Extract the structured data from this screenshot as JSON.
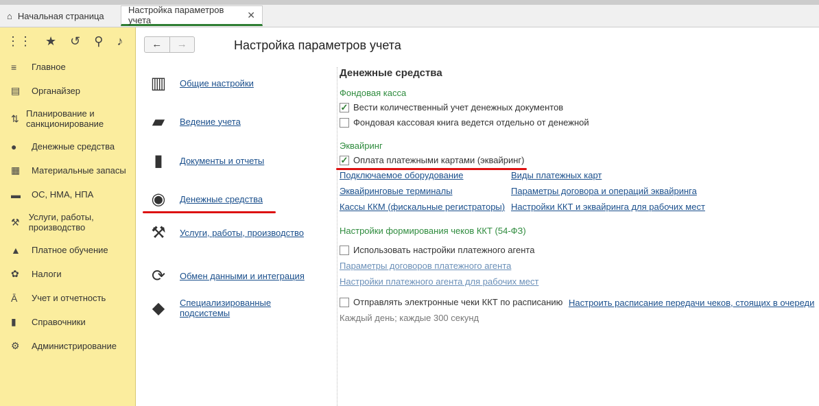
{
  "tabs": {
    "home": "Начальная страница",
    "active": "Настройка параметров учета"
  },
  "sidebar": {
    "items": [
      {
        "icon": "menu-icon",
        "label": "Главное"
      },
      {
        "icon": "organizer-icon",
        "label": "Органайзер"
      },
      {
        "icon": "planning-icon",
        "label": "Планирование и санкционирование"
      },
      {
        "icon": "money-icon",
        "label": "Денежные средства"
      },
      {
        "icon": "stock-icon",
        "label": "Материальные запасы"
      },
      {
        "icon": "truck-icon",
        "label": "ОС, НМА, НПА"
      },
      {
        "icon": "services-icon",
        "label": "Услуги, работы, производство"
      },
      {
        "icon": "education-icon",
        "label": "Платное обучение"
      },
      {
        "icon": "taxes-icon",
        "label": "Налоги"
      },
      {
        "icon": "reporting-icon",
        "label": "Учет и отчетность"
      },
      {
        "icon": "reference-icon",
        "label": "Справочники"
      },
      {
        "icon": "gear-icon",
        "label": "Администрирование"
      }
    ]
  },
  "page": {
    "title": "Настройка параметров учета"
  },
  "menu": [
    {
      "label": "Общие настройки",
      "icon": "building-icon"
    },
    {
      "label": "Ведение учета",
      "icon": "folder-icon"
    },
    {
      "label": "Документы и отчеты",
      "icon": "binder-icon"
    },
    {
      "label": "Денежные средства",
      "icon": "coins-icon"
    },
    {
      "label": "Услуги, работы, производство",
      "icon": "toolbox-icon"
    },
    {
      "label": "Обмен данными и интеграция",
      "icon": "sync-icon"
    },
    {
      "label": "Специализированные подсистемы",
      "icon": "cubes-icon"
    }
  ],
  "money": {
    "heading": "Денежные средства",
    "fund_group": "Фондовая касса",
    "fund_opt1": "Вести количественный учет денежных документов",
    "fund_opt1_checked": true,
    "fund_opt2": "Фондовая кассовая книга ведется отдельно от денежной",
    "fund_opt2_checked": false,
    "acq_group": "Эквайринг",
    "acq_opt": "Оплата платежными картами (эквайринг)",
    "acq_opt_checked": true,
    "l1": "Подключаемое оборудование",
    "l2": "Виды платежных карт",
    "l3": "Эквайринговые терминалы",
    "l4": "Параметры договора и операций эквайринга",
    "l5": "Кассы ККМ (фискальные регистраторы)",
    "l6": "Настройки ККТ и эквайринга для рабочих мест",
    "kkt_group": "Настройки формирования чеков ККТ (54-ФЗ)",
    "agent_opt": "Использовать настройки платежного агента",
    "agent_opt_checked": false,
    "agent_l1": "Параметры договоров платежного агента",
    "agent_l2": "Настройки платежного агента для рабочих мест",
    "sched_opt": "Отправлять электронные чеки ККТ по расписанию",
    "sched_opt_checked": false,
    "sched_link": "Настроить расписание передачи чеков, стоящих в очереди",
    "sched_note": "Каждый день; каждые 300 секунд"
  }
}
